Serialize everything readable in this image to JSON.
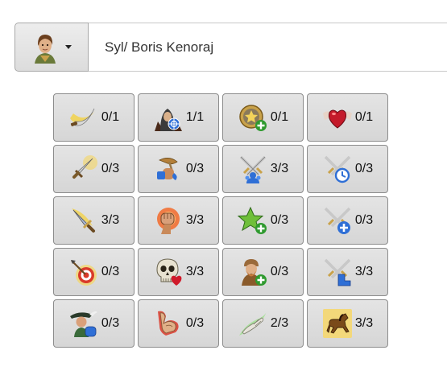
{
  "hero": {
    "portrait_icon": "hero-portrait-icon",
    "name_value": "Syl/ Boris Kenoraj"
  },
  "skills": [
    {
      "icon": "scimitar-swing-icon",
      "count": "0/1"
    },
    {
      "icon": "hooded-archer-target-icon",
      "count": "1/1"
    },
    {
      "icon": "gold-star-medallion-plus-icon",
      "count": "0/1"
    },
    {
      "icon": "winged-heart-icon",
      "count": "0/1"
    },
    {
      "icon": "sword-glow-icon",
      "count": "0/3"
    },
    {
      "icon": "horn-hand-icon",
      "count": "0/3"
    },
    {
      "icon": "crossed-swords-unit-icon",
      "count": "3/3"
    },
    {
      "icon": "crossed-swords-clock-icon",
      "count": "0/3"
    },
    {
      "icon": "dagger-strike-icon",
      "count": "3/3"
    },
    {
      "icon": "fist-burst-icon",
      "count": "3/3"
    },
    {
      "icon": "green-star-plus-icon",
      "count": "0/3"
    },
    {
      "icon": "crossed-swords-plus-icon",
      "count": "0/3"
    },
    {
      "icon": "arrow-target-icon",
      "count": "0/3"
    },
    {
      "icon": "skull-heart-icon",
      "count": "3/3"
    },
    {
      "icon": "dwarf-plus-icon",
      "count": "0/3"
    },
    {
      "icon": "crossed-swords-boot-icon",
      "count": "3/3"
    },
    {
      "icon": "feathered-hat-fist-icon",
      "count": "0/3"
    },
    {
      "icon": "flexing-arm-icon",
      "count": "0/3"
    },
    {
      "icon": "healing-hand-icon",
      "count": "2/3"
    },
    {
      "icon": "galloping-horse-icon",
      "count": "3/3"
    }
  ]
}
